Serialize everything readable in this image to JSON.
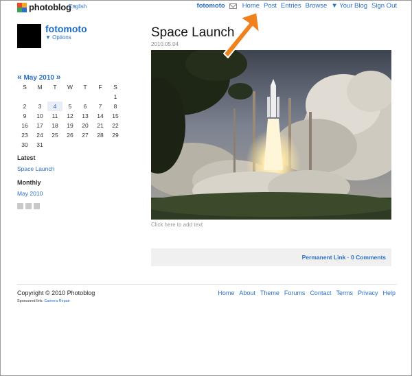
{
  "header": {
    "logo_text": "photoblog",
    "logo_tm": "™",
    "language": "English",
    "user": "fotomoto",
    "nav": [
      "Home",
      "Post",
      "Entries",
      "Browse",
      "▼ Your Blog",
      "Sign Out"
    ]
  },
  "profile": {
    "name": "fotomoto",
    "options": "▼ Options"
  },
  "calendar": {
    "prev": "«",
    "month": "May 2010",
    "next": "»",
    "weekdays": [
      "S",
      "M",
      "T",
      "W",
      "T",
      "F",
      "S"
    ],
    "weeks": [
      [
        "",
        "",
        "",
        "",
        "",
        "",
        "1"
      ],
      [
        "2",
        "3",
        "4",
        "5",
        "6",
        "7",
        "8"
      ],
      [
        "9",
        "10",
        "11",
        "12",
        "13",
        "14",
        "15"
      ],
      [
        "16",
        "17",
        "18",
        "19",
        "20",
        "21",
        "22"
      ],
      [
        "23",
        "24",
        "25",
        "26",
        "27",
        "28",
        "29"
      ],
      [
        "30",
        "31",
        "",
        "",
        "",
        "",
        ""
      ]
    ],
    "highlight": "4"
  },
  "sidebar": {
    "latest_title": "Latest",
    "latest_link": "Space Launch",
    "monthly_title": "Monthly",
    "monthly_link": "May 2010"
  },
  "post": {
    "title": "Space Launch",
    "date": "2010.05.04",
    "caption": "Click here to add text",
    "permalink": "Permanent Link",
    "separator": " · ",
    "comments": "0 Comments"
  },
  "footer": {
    "copyright": "Copyright © 2010 Photoblog",
    "sponsored_prefix": "Sponsored link:",
    "sponsored_link": "Camera Repair",
    "nav": [
      "Home",
      "About",
      "Theme",
      "Forums",
      "Contact",
      "Terms",
      "Privacy",
      "Help"
    ]
  },
  "colors": {
    "link": "#2a6fc9",
    "pointer": "#f0821e"
  }
}
